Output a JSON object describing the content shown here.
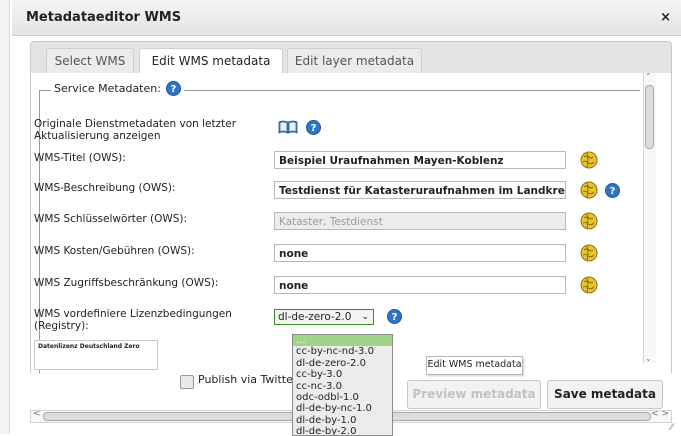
{
  "dialog": {
    "title": "Metadataeditor WMS",
    "close_glyph": "×"
  },
  "tabs": [
    {
      "label": "Select WMS",
      "active": false
    },
    {
      "label": "Edit WMS metadata",
      "active": true
    },
    {
      "label": "Edit layer metadata",
      "active": false
    }
  ],
  "service": {
    "legend": "Service Metadaten:",
    "fields": {
      "original": {
        "label": "Originale Dienstmetadaten von letzter Aktualisierung anzeigen"
      },
      "title": {
        "label": "WMS-Titel (OWS):",
        "value": "Beispiel Uraufnahmen Mayen-Koblenz"
      },
      "description": {
        "label": "WMS-Beschreibung (OWS):",
        "value": "Testdienst für Katasteruraufnahmen im Landkreis Mayen-Koblenz"
      },
      "keywords": {
        "label": "WMS Schlüsselwörter (OWS):",
        "value": "Kataster, Testdienst"
      },
      "fees": {
        "label": "WMS Kosten/Gebühren (OWS):",
        "value": "none"
      },
      "access": {
        "label": "WMS Zugriffsbeschränkung (OWS):",
        "value": "none"
      },
      "license": {
        "label": "WMS vordefiniere Lizenzbedingungen (Registry):",
        "selected": "dl-de-zero-2.0"
      }
    },
    "license_preview": "Datenlizenz Deutschland Zero"
  },
  "dropdown": {
    "options": [
      "...",
      "cc-by-nc-nd-3.0",
      "dl-de-zero-2.0",
      "cc-by-3.0",
      "cc-nc-3.0",
      "odc-odbl-1.0",
      "dl-de-by-nc-1.0",
      "dl-de-by-1.0",
      "dl-de-by-2.0"
    ],
    "highlighted_index": 0
  },
  "tooltip": {
    "text": "Edit WMS metadata"
  },
  "footer": {
    "publish_label": "Publish via Twitter and RSS",
    "preview_button": "Preview metadata",
    "save_button": "Save metadata"
  },
  "icons": {
    "help": "help-icon",
    "globe": "globe-icon",
    "book": "book-icon"
  },
  "colors": {
    "help_blue": "#2f75c6",
    "select_border": "#3c8a1f",
    "dropdown_highlight": "#a1d38a",
    "globe_yellow": "#e8c52a"
  }
}
